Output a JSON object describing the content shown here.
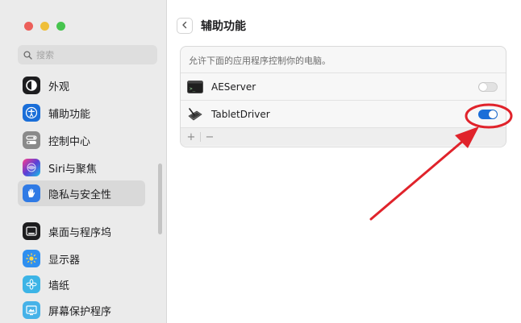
{
  "window": {
    "traffic_lights": {
      "close_color": "#ec5f5a",
      "minimize_color": "#efbf3a",
      "zoom_color": "#46c44e"
    }
  },
  "sidebar": {
    "search_placeholder": "搜索",
    "items": [
      {
        "label": "外观",
        "icon": "appearance-icon",
        "color": "#1d1d1f"
      },
      {
        "label": "辅助功能",
        "icon": "accessibility-icon",
        "color": "#1a6ed8"
      },
      {
        "label": "控制中心",
        "icon": "control-center-icon",
        "color": "#7b7b7b"
      },
      {
        "label": "Siri与聚焦",
        "icon": "siri-icon",
        "color": "#5b3fd6"
      },
      {
        "label": "隐私与安全性",
        "icon": "privacy-hand-icon",
        "color": "#2f7ae5",
        "selected": true
      },
      {
        "label": "桌面与程序坞",
        "icon": "desktop-dock-icon",
        "color": "#1d1d1f"
      },
      {
        "label": "显示器",
        "icon": "display-sun-icon",
        "color": "#2f8ff0"
      },
      {
        "label": "墙纸",
        "icon": "wallpaper-flower-icon",
        "color": "#3cb4e6"
      },
      {
        "label": "屏幕保护程序",
        "icon": "screensaver-icon",
        "color": "#46b2e8"
      }
    ]
  },
  "main": {
    "back_label": "<",
    "title": "辅助功能",
    "description": "允许下面的应用程序控制你的电脑。",
    "apps": [
      {
        "name": "AEServer",
        "icon": "terminal-app-icon",
        "enabled": false
      },
      {
        "name": "TabletDriver",
        "icon": "tablet-pen-icon",
        "enabled": true
      }
    ],
    "add_label": "+",
    "remove_label": "−"
  },
  "colors": {
    "accent": "#1a6ed8",
    "annotation_red": "#e0232b"
  }
}
